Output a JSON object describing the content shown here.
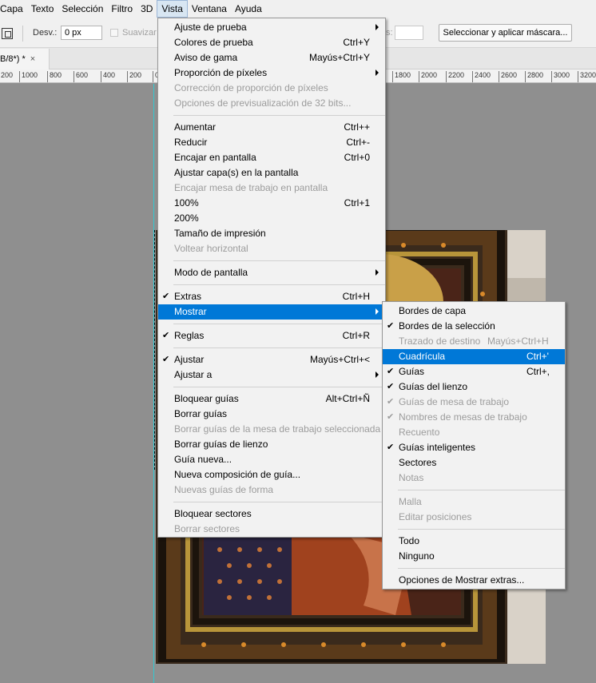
{
  "menubar": {
    "items": [
      "Capa",
      "Texto",
      "Selección",
      "Filtro",
      "3D",
      "Vista",
      "Ventana",
      "Ayuda"
    ]
  },
  "options_bar": {
    "desv_label": "Desv.:",
    "desv_value": "0 px",
    "suavizar_label": "Suavizar",
    "colon": "s:",
    "mask_button": "Seleccionar y aplicar máscara..."
  },
  "tab": {
    "title": "B/8*) *",
    "close": "×"
  },
  "ruler": {
    "ticks": [
      "200",
      "1000",
      "800",
      "600",
      "400",
      "200",
      "0",
      "1800",
      "2000",
      "2200",
      "2400",
      "2600",
      "2800",
      "3000",
      "3200"
    ]
  },
  "vista_menu": {
    "items": [
      {
        "label": "Ajuste de prueba",
        "submenu": true
      },
      {
        "label": "Colores de prueba",
        "shortcut": "Ctrl+Y"
      },
      {
        "label": "Aviso de gama",
        "shortcut": "Mayús+Ctrl+Y"
      },
      {
        "label": "Proporción de píxeles",
        "submenu": true
      },
      {
        "label": "Corrección de proporción de píxeles",
        "disabled": true
      },
      {
        "label": "Opciones de previsualización de 32 bits...",
        "disabled": true
      },
      {
        "separator": true
      },
      {
        "label": "Aumentar",
        "shortcut": "Ctrl++"
      },
      {
        "label": "Reducir",
        "shortcut": "Ctrl+-"
      },
      {
        "label": "Encajar en pantalla",
        "shortcut": "Ctrl+0"
      },
      {
        "label": "Ajustar capa(s) en la pantalla"
      },
      {
        "label": "Encajar mesa de trabajo en pantalla",
        "disabled": true
      },
      {
        "label": "100%",
        "shortcut": "Ctrl+1"
      },
      {
        "label": "200%"
      },
      {
        "label": "Tamaño de impresión"
      },
      {
        "label": "Voltear horizontal",
        "disabled": true
      },
      {
        "separator": true
      },
      {
        "label": "Modo de pantalla",
        "submenu": true
      },
      {
        "separator": true
      },
      {
        "label": "Extras",
        "shortcut": "Ctrl+H",
        "checked": true
      },
      {
        "label": "Mostrar",
        "submenu": true,
        "highlighted": true
      },
      {
        "separator": true
      },
      {
        "label": "Reglas",
        "shortcut": "Ctrl+R",
        "checked": true
      },
      {
        "separator": true
      },
      {
        "label": "Ajustar",
        "shortcut": "Mayús+Ctrl+<",
        "checked": true
      },
      {
        "label": "Ajustar a",
        "submenu": true
      },
      {
        "separator": true
      },
      {
        "label": "Bloquear guías",
        "shortcut": "Alt+Ctrl+Ñ"
      },
      {
        "label": "Borrar guías"
      },
      {
        "label": "Borrar guías de la mesa de trabajo seleccionada",
        "disabled": true
      },
      {
        "label": "Borrar guías de lienzo"
      },
      {
        "label": "Guía nueva..."
      },
      {
        "label": "Nueva composición de guía..."
      },
      {
        "label": "Nuevas guías de forma",
        "disabled": true
      },
      {
        "separator": true
      },
      {
        "label": "Bloquear sectores"
      },
      {
        "label": "Borrar sectores",
        "disabled": true
      }
    ]
  },
  "mostrar_menu": {
    "items": [
      {
        "label": "Bordes de capa"
      },
      {
        "label": "Bordes de la selección",
        "checked": true
      },
      {
        "label": "Trazado de destino",
        "shortcut": "Mayús+Ctrl+H",
        "disabled": true
      },
      {
        "label": "Cuadrícula",
        "shortcut": "Ctrl+'",
        "highlighted": true
      },
      {
        "label": "Guías",
        "shortcut": "Ctrl+,",
        "checked": true
      },
      {
        "label": "Guías del lienzo",
        "checked": true
      },
      {
        "label": "Guías de mesa de trabajo",
        "checked": true,
        "disabled": true
      },
      {
        "label": "Nombres de mesas de trabajo",
        "checked": true,
        "disabled": true
      },
      {
        "label": "Recuento",
        "disabled": true
      },
      {
        "label": "Guías inteligentes",
        "checked": true
      },
      {
        "label": "Sectores"
      },
      {
        "label": "Notas",
        "disabled": true
      },
      {
        "separator": true
      },
      {
        "label": "Malla",
        "disabled": true
      },
      {
        "label": "Editar posiciones",
        "disabled": true
      },
      {
        "separator": true
      },
      {
        "label": "Todo"
      },
      {
        "label": "Ninguno"
      },
      {
        "separator": true
      },
      {
        "label": "Opciones de Mostrar extras..."
      }
    ]
  },
  "colors": {
    "highlight": "#0078d7",
    "guide": "#32c8d2",
    "disabled_text": "#9c9c9c"
  }
}
